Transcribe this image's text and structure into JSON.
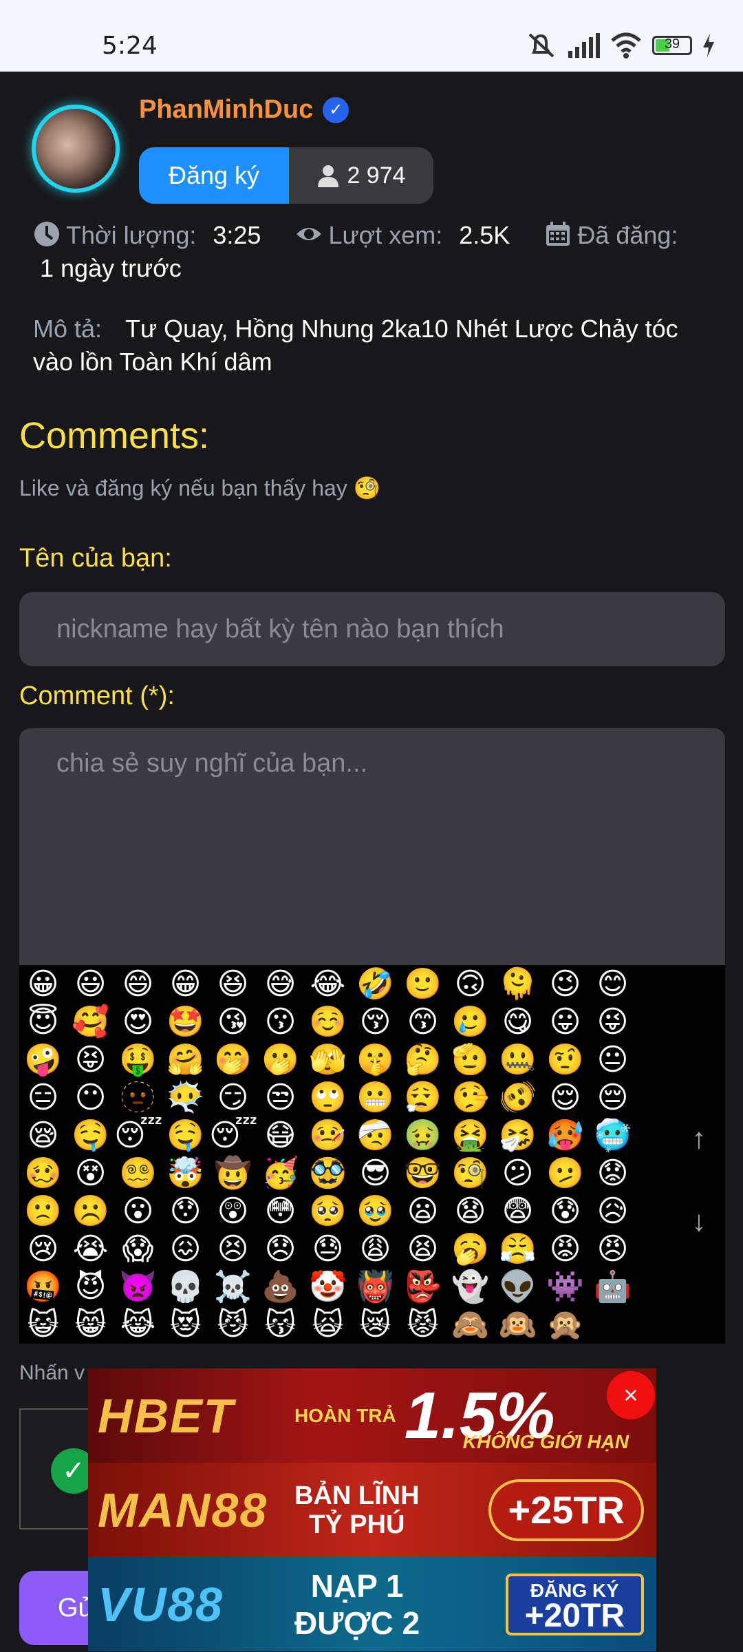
{
  "status": {
    "time": "5:24",
    "battery": "39",
    "battery_level": 0.39
  },
  "channel": {
    "name": "PhanMinhDuc",
    "subscribe_label": "Đăng ký",
    "subscriber_count": "2 974"
  },
  "meta": {
    "duration_label": "Thời lượng:",
    "duration": "3:25",
    "views_label": "Lượt xem:",
    "views": "2.5K",
    "posted_label": "Đã đăng:",
    "posted": "1 ngày trước"
  },
  "description": {
    "label": "Mô tả:",
    "text": "Tư Quay, Hồng Nhung 2ka10 Nhét Lược Chảy tóc vào lồn Toàn Khí dâm"
  },
  "comments": {
    "title": "Comments:",
    "like_text": "Like và đăng ký nếu bạn thấy hay 🧐",
    "name_label": "Tên của bạn:",
    "name_placeholder": "nickname hay bất kỳ tên nào bạn thích",
    "comment_label": "Comment (*):",
    "comment_placeholder": "chia sẻ suy nghĩ của bạn...",
    "hint": "Nhấn v",
    "send_label": "Gử"
  },
  "emojis": [
    "😀",
    "😃",
    "😄",
    "😁",
    "😆",
    "😅",
    "😂",
    "🤣",
    "🙂",
    "🙃",
    "🫠",
    "😉",
    "😊",
    "😇",
    "🥰",
    "😍",
    "🤩",
    "😘",
    "😗",
    "☺️",
    "😚",
    "😙",
    "🥲",
    "😋",
    "😛",
    "😜",
    "🤪",
    "😝",
    "🤑",
    "🤗",
    "🤭",
    "🫢",
    "🫣",
    "🤫",
    "🤔",
    "🫡",
    "🤐",
    "🤨",
    "😐",
    "😑",
    "😶",
    "🫥",
    "😶‍🌫️",
    "😏",
    "😒",
    "🙄",
    "😬",
    "😮‍💨",
    "🤥",
    "🫨",
    "😌",
    "😔",
    "😪",
    "🤤",
    "😴",
    "🤤",
    "😴",
    "😷",
    "🤒",
    "🤕",
    "🤢",
    "🤮",
    "🤧",
    "🥵",
    "🥶",
    "🥴",
    "😵",
    "😵‍💫",
    "🤯",
    "🤠",
    "🥳",
    "🥸",
    "😎",
    "🤓",
    "🧐",
    "😕",
    "🫤",
    "😟",
    "🙁",
    "☹️",
    "😮",
    "😯",
    "😲",
    "😳",
    "🥺",
    "🥹",
    "😦",
    "😧",
    "😨",
    "😰",
    "😥",
    "😢",
    "😭",
    "😱",
    "😖",
    "😣",
    "😞",
    "😓",
    "😩",
    "😫",
    "🥱",
    "😤",
    "😡",
    "😠",
    "🤬",
    "😈",
    "👿",
    "💀",
    "☠️",
    "💩",
    "🤡",
    "👹",
    "👺",
    "👻",
    "👽",
    "👾",
    "🤖",
    "😺",
    "😸",
    "😹",
    "😻",
    "😼",
    "😽",
    "🙀",
    "😿",
    "😾",
    "🙈",
    "🙉",
    "🙊"
  ],
  "emoji_scroll": {
    "up": "↑",
    "down": "↓"
  },
  "ads": {
    "ad1": {
      "brand": "HBET",
      "sub": "HOÀN TRẢ",
      "pct": "1.5%",
      "note": "KHÔNG GIỚI HẠN"
    },
    "ad2": {
      "brand": "MAN88",
      "line1": "BẢN LĨNH",
      "line2": "TỶ PHÚ",
      "pill": "+25TR"
    },
    "ad3": {
      "brand": "VU88",
      "line1": "NẠP 1",
      "line2": "ĐƯỢC 2",
      "pill_top": "ĐĂNG KÝ",
      "pill": "+20TR"
    },
    "close": "×"
  }
}
